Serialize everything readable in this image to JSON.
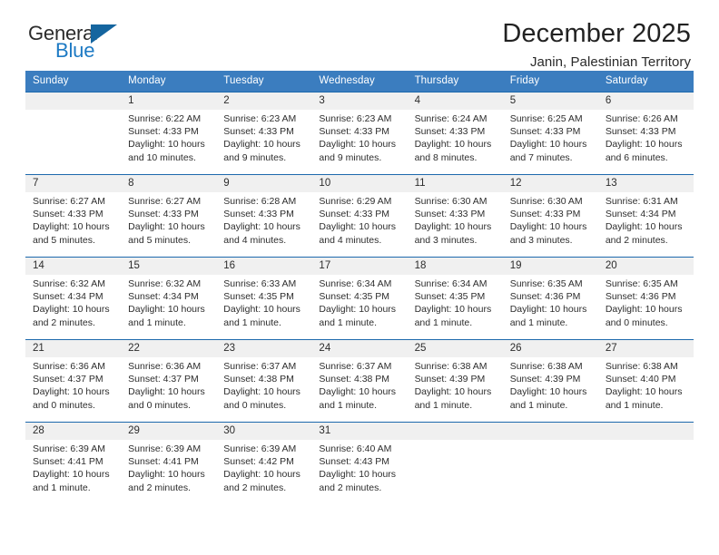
{
  "brand": {
    "name_top": "General",
    "name_bottom": "Blue",
    "accent_color": "#1d7ac4",
    "triangle_color": "#15659f"
  },
  "header": {
    "title": "December 2025",
    "subtitle": "Janin, Palestinian Territory"
  },
  "calendar": {
    "header_bg": "#3b7dbf",
    "row_divider_color": "#1d69ad",
    "daynum_band_color": "#f0f0f0",
    "weekdays": [
      "Sunday",
      "Monday",
      "Tuesday",
      "Wednesday",
      "Thursday",
      "Friday",
      "Saturday"
    ],
    "weeks": [
      [
        {
          "day": "",
          "text": ""
        },
        {
          "day": "1",
          "text": "Sunrise: 6:22 AM\nSunset: 4:33 PM\nDaylight: 10 hours\nand 10 minutes."
        },
        {
          "day": "2",
          "text": "Sunrise: 6:23 AM\nSunset: 4:33 PM\nDaylight: 10 hours\nand 9 minutes."
        },
        {
          "day": "3",
          "text": "Sunrise: 6:23 AM\nSunset: 4:33 PM\nDaylight: 10 hours\nand 9 minutes."
        },
        {
          "day": "4",
          "text": "Sunrise: 6:24 AM\nSunset: 4:33 PM\nDaylight: 10 hours\nand 8 minutes."
        },
        {
          "day": "5",
          "text": "Sunrise: 6:25 AM\nSunset: 4:33 PM\nDaylight: 10 hours\nand 7 minutes."
        },
        {
          "day": "6",
          "text": "Sunrise: 6:26 AM\nSunset: 4:33 PM\nDaylight: 10 hours\nand 6 minutes."
        }
      ],
      [
        {
          "day": "7",
          "text": "Sunrise: 6:27 AM\nSunset: 4:33 PM\nDaylight: 10 hours\nand 5 minutes."
        },
        {
          "day": "8",
          "text": "Sunrise: 6:27 AM\nSunset: 4:33 PM\nDaylight: 10 hours\nand 5 minutes."
        },
        {
          "day": "9",
          "text": "Sunrise: 6:28 AM\nSunset: 4:33 PM\nDaylight: 10 hours\nand 4 minutes."
        },
        {
          "day": "10",
          "text": "Sunrise: 6:29 AM\nSunset: 4:33 PM\nDaylight: 10 hours\nand 4 minutes."
        },
        {
          "day": "11",
          "text": "Sunrise: 6:30 AM\nSunset: 4:33 PM\nDaylight: 10 hours\nand 3 minutes."
        },
        {
          "day": "12",
          "text": "Sunrise: 6:30 AM\nSunset: 4:33 PM\nDaylight: 10 hours\nand 3 minutes."
        },
        {
          "day": "13",
          "text": "Sunrise: 6:31 AM\nSunset: 4:34 PM\nDaylight: 10 hours\nand 2 minutes."
        }
      ],
      [
        {
          "day": "14",
          "text": "Sunrise: 6:32 AM\nSunset: 4:34 PM\nDaylight: 10 hours\nand 2 minutes."
        },
        {
          "day": "15",
          "text": "Sunrise: 6:32 AM\nSunset: 4:34 PM\nDaylight: 10 hours\nand 1 minute."
        },
        {
          "day": "16",
          "text": "Sunrise: 6:33 AM\nSunset: 4:35 PM\nDaylight: 10 hours\nand 1 minute."
        },
        {
          "day": "17",
          "text": "Sunrise: 6:34 AM\nSunset: 4:35 PM\nDaylight: 10 hours\nand 1 minute."
        },
        {
          "day": "18",
          "text": "Sunrise: 6:34 AM\nSunset: 4:35 PM\nDaylight: 10 hours\nand 1 minute."
        },
        {
          "day": "19",
          "text": "Sunrise: 6:35 AM\nSunset: 4:36 PM\nDaylight: 10 hours\nand 1 minute."
        },
        {
          "day": "20",
          "text": "Sunrise: 6:35 AM\nSunset: 4:36 PM\nDaylight: 10 hours\nand 0 minutes."
        }
      ],
      [
        {
          "day": "21",
          "text": "Sunrise: 6:36 AM\nSunset: 4:37 PM\nDaylight: 10 hours\nand 0 minutes."
        },
        {
          "day": "22",
          "text": "Sunrise: 6:36 AM\nSunset: 4:37 PM\nDaylight: 10 hours\nand 0 minutes."
        },
        {
          "day": "23",
          "text": "Sunrise: 6:37 AM\nSunset: 4:38 PM\nDaylight: 10 hours\nand 0 minutes."
        },
        {
          "day": "24",
          "text": "Sunrise: 6:37 AM\nSunset: 4:38 PM\nDaylight: 10 hours\nand 1 minute."
        },
        {
          "day": "25",
          "text": "Sunrise: 6:38 AM\nSunset: 4:39 PM\nDaylight: 10 hours\nand 1 minute."
        },
        {
          "day": "26",
          "text": "Sunrise: 6:38 AM\nSunset: 4:39 PM\nDaylight: 10 hours\nand 1 minute."
        },
        {
          "day": "27",
          "text": "Sunrise: 6:38 AM\nSunset: 4:40 PM\nDaylight: 10 hours\nand 1 minute."
        }
      ],
      [
        {
          "day": "28",
          "text": "Sunrise: 6:39 AM\nSunset: 4:41 PM\nDaylight: 10 hours\nand 1 minute."
        },
        {
          "day": "29",
          "text": "Sunrise: 6:39 AM\nSunset: 4:41 PM\nDaylight: 10 hours\nand 2 minutes."
        },
        {
          "day": "30",
          "text": "Sunrise: 6:39 AM\nSunset: 4:42 PM\nDaylight: 10 hours\nand 2 minutes."
        },
        {
          "day": "31",
          "text": "Sunrise: 6:40 AM\nSunset: 4:43 PM\nDaylight: 10 hours\nand 2 minutes."
        },
        {
          "day": "",
          "text": ""
        },
        {
          "day": "",
          "text": ""
        },
        {
          "day": "",
          "text": ""
        }
      ]
    ]
  }
}
